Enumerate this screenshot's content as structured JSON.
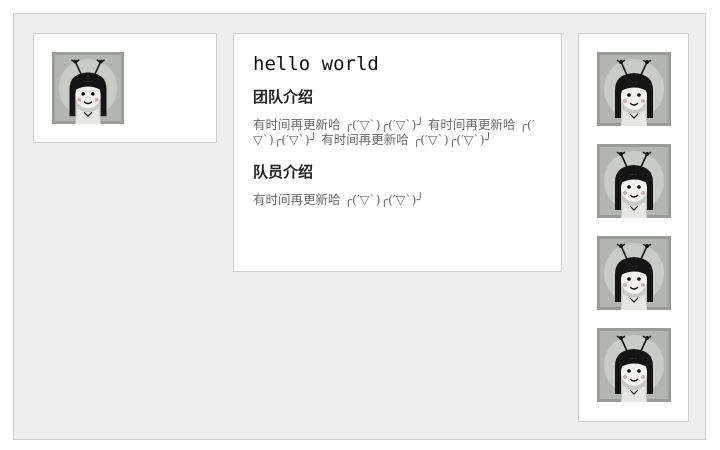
{
  "intro": {
    "title": "hello world",
    "team": {
      "heading": "团队介绍",
      "body": "有时间再更新哈 ╭(′▽`)╭(′▽`)╯ 有时间再更新哈 ╭(′▽`)╭(′▽`)╯ 有时间再更新哈 ╭(′▽`)╭(′▽`)╯"
    },
    "members": {
      "heading": "队员介绍",
      "body": "有时间再更新哈 ╭(′▽`)╭(′▽`)╯"
    }
  },
  "avatars": {
    "icon": "cartoon-girl-avatar",
    "left_count": 1,
    "right_count": 4
  },
  "colors": {
    "page_bg": "#ffffff",
    "frame_bg": "#eeeeee",
    "border": "#cfcfcf",
    "text_dark": "#111111",
    "text_muted": "#6a6a6a"
  }
}
